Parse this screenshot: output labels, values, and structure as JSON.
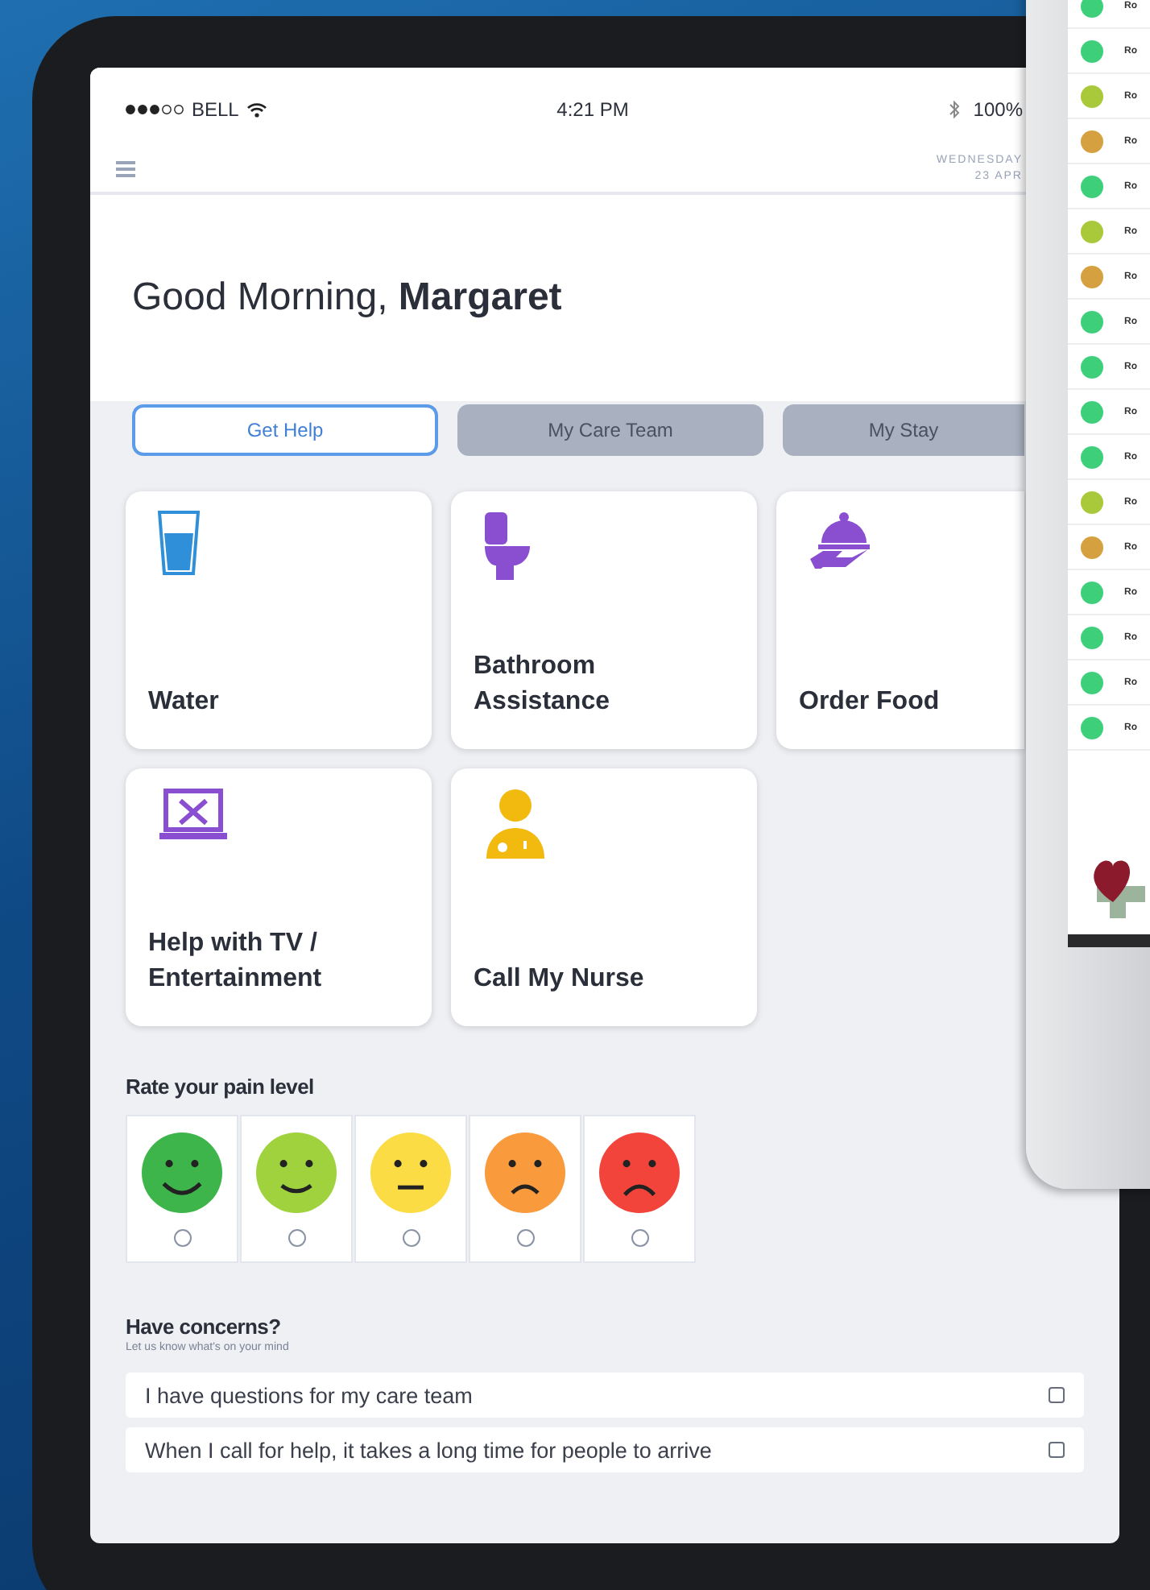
{
  "status_bar": {
    "carrier": "BELL",
    "time": "4:21 PM",
    "battery": "100%"
  },
  "header": {
    "day": "WEDNESDAY",
    "date": "23 APR"
  },
  "greeting": "Good Morning, **Margaret**",
  "tabs": [
    {
      "label": "Get Help",
      "selected": true
    },
    {
      "label": "My Care Team",
      "selected": false
    },
    {
      "label": "My Stay",
      "selected": false
    }
  ],
  "tiles": [
    {
      "label": "Water",
      "kind": "water"
    },
    {
      "label": "Bathroom Assistance",
      "kind": "toilet"
    },
    {
      "label": "Order Food",
      "kind": "food"
    },
    {
      "label": "Help with TV / Entertainment",
      "kind": "tv"
    },
    {
      "label": "Call My Nurse",
      "kind": "nurse"
    }
  ],
  "pain": {
    "title": "Rate your pain level",
    "faces": [
      {
        "kind": "happy",
        "color": "#3db54a",
        "selected": false
      },
      {
        "kind": "smile",
        "color": "#9fd23c",
        "selected": false
      },
      {
        "kind": "neutral",
        "color": "#fbdc45",
        "selected": false
      },
      {
        "kind": "sad",
        "color": "#f99a3c",
        "selected": false
      },
      {
        "kind": "upset",
        "color": "#f2443a",
        "selected": false
      }
    ]
  },
  "concerns": {
    "title": "Have concerns?",
    "subtitle": "Let us know what's on your mind",
    "items": [
      {
        "label": "I have questions for my care team",
        "checked": false
      },
      {
        "label": "When I call for help, it takes a long time for people to arrive",
        "checked": false
      }
    ]
  },
  "back_device": {
    "rows": [
      {
        "label": "Ro",
        "color": "#3ecf7a"
      },
      {
        "label": "Ro",
        "color": "#3ecf7a"
      },
      {
        "label": "Ro",
        "color": "#a9c93a"
      },
      {
        "label": "Ro",
        "color": "#d4a040"
      },
      {
        "label": "Ro",
        "color": "#3ecf7a"
      },
      {
        "label": "Ro",
        "color": "#a9c93a"
      },
      {
        "label": "Ro",
        "color": "#d4a040"
      },
      {
        "label": "Ro",
        "color": "#3ecf7a"
      },
      {
        "label": "Ro",
        "color": "#3ecf7a"
      },
      {
        "label": "Ro",
        "color": "#3ecf7a"
      },
      {
        "label": "Ro",
        "color": "#3ecf7a"
      },
      {
        "label": "Ro",
        "color": "#a9c93a"
      },
      {
        "label": "Ro",
        "color": "#d4a040"
      },
      {
        "label": "Ro",
        "color": "#3ecf7a"
      },
      {
        "label": "Ro",
        "color": "#3ecf7a"
      },
      {
        "label": "Ro",
        "color": "#3ecf7a"
      },
      {
        "label": "Ro",
        "color": "#3ecf7a"
      }
    ]
  }
}
